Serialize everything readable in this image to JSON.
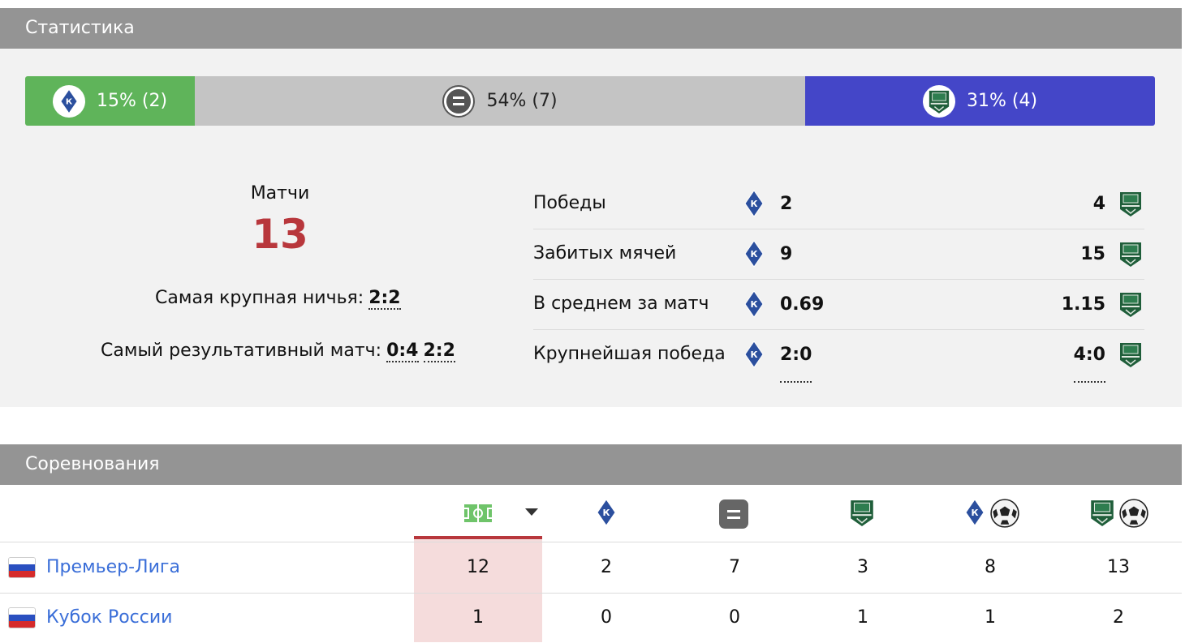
{
  "statistics": {
    "header": "Статистика",
    "bar": {
      "home": "15% (2)",
      "draw": "54% (7)",
      "away": "31% (4)",
      "home_share": 0.15,
      "draw_share": 0.54,
      "away_share": 0.31,
      "colors": {
        "home": "#5fb45a",
        "draw": "#c4c4c4",
        "away": "#4446c8"
      }
    },
    "matches_label": "Матчи",
    "matches_count": "13",
    "biggest_draw_label": "Самая крупная ничья:",
    "biggest_draw_score": "2:2",
    "most_goals_label": "Самый результативный матч:",
    "most_goals_scores": [
      "0:4",
      "2:2"
    ],
    "rows": [
      {
        "label": "Победы",
        "home": "2",
        "away": "4"
      },
      {
        "label": "Забитых мячей",
        "home": "9",
        "away": "15"
      },
      {
        "label": "В среднем за матч",
        "home": "0.69",
        "away": "1.15"
      },
      {
        "label": "Крупнейшая победа",
        "home": "2:0",
        "away": "4:0"
      }
    ],
    "icons": {
      "home": "krylia-sovetov-logo-icon",
      "away": "krasnodar-logo-icon",
      "draw": "equals-icon"
    }
  },
  "competitions": {
    "header": "Соревнования",
    "columns": [
      "field-icon",
      "krylia-sovetov-logo-icon",
      "draw-icon",
      "krasnodar-logo-icon",
      "home-goals-icon",
      "away-goals-icon"
    ],
    "rows": [
      {
        "name": "Премьер-Лига",
        "flag": "russia-flag-icon",
        "cells": [
          "12",
          "2",
          "7",
          "3",
          "8",
          "13"
        ]
      },
      {
        "name": "Кубок России",
        "flag": "russia-flag-icon",
        "cells": [
          "1",
          "0",
          "0",
          "1",
          "1",
          "2"
        ]
      }
    ]
  }
}
